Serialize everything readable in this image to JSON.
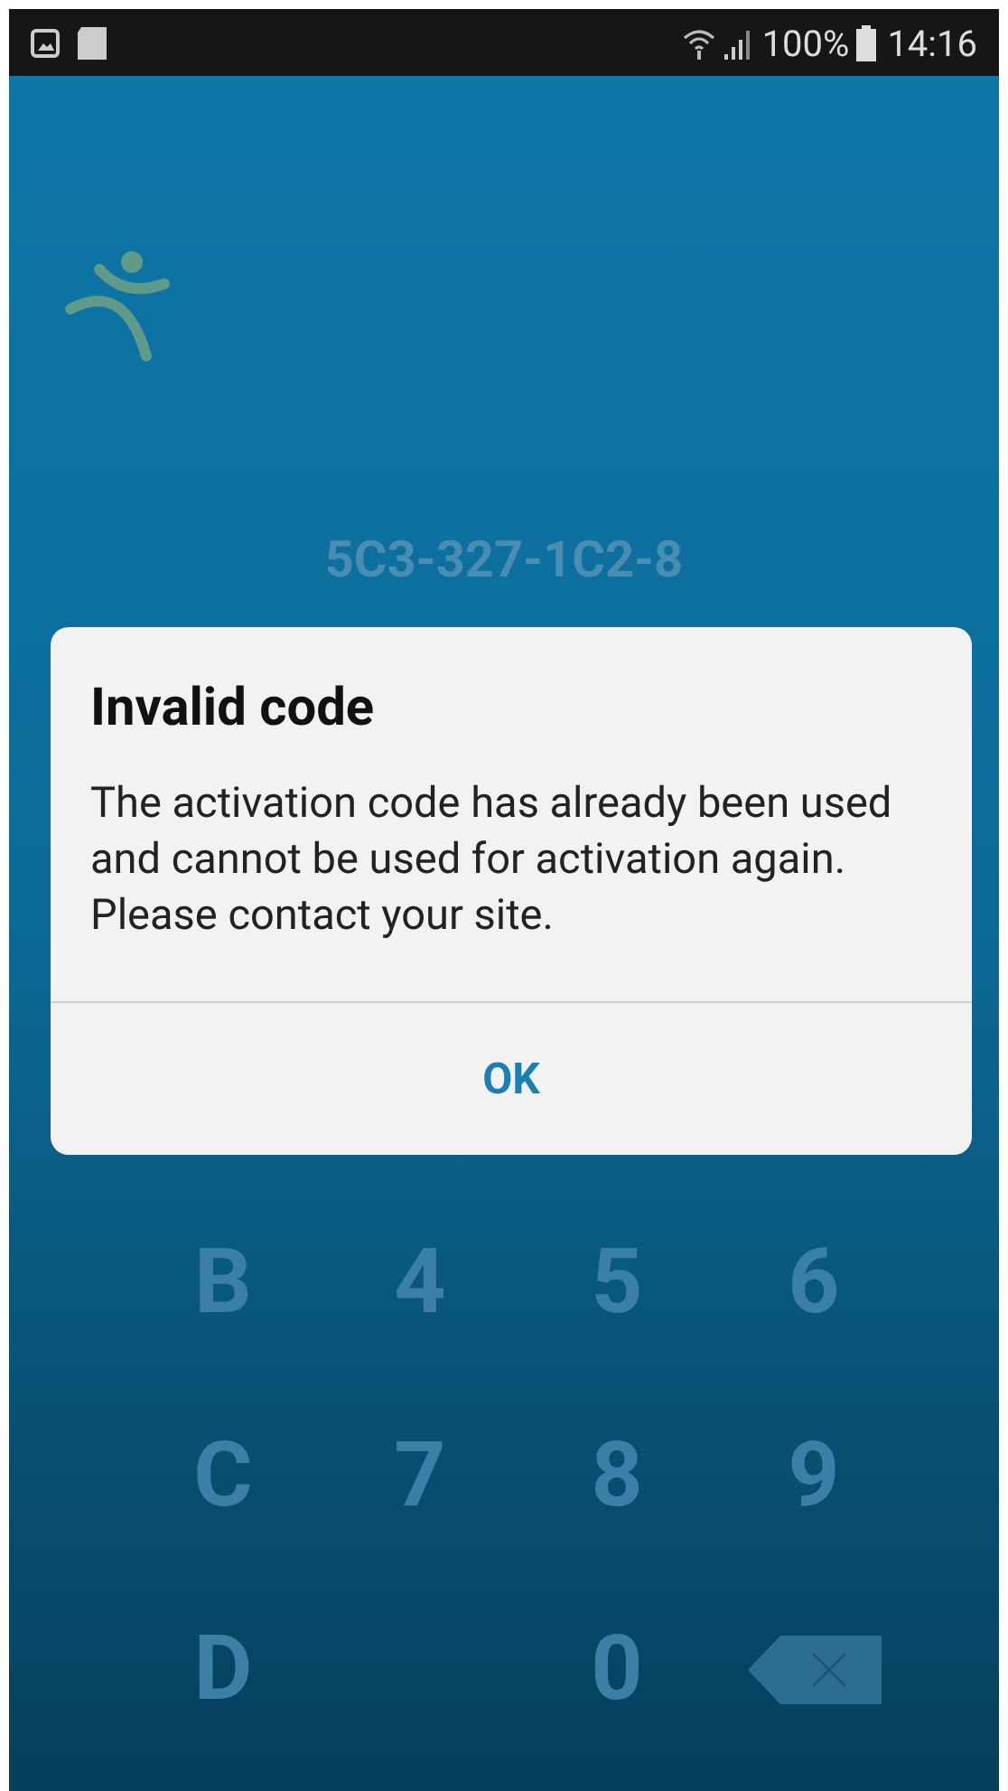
{
  "status_bar": {
    "battery": "100%",
    "time": "14:16"
  },
  "activation_code": "5C3-327-1C2-8",
  "keypad": [
    {
      "kind": "key",
      "label": "B"
    },
    {
      "kind": "key",
      "label": "4"
    },
    {
      "kind": "key",
      "label": "5"
    },
    {
      "kind": "key",
      "label": "6"
    },
    {
      "kind": "key",
      "label": "C"
    },
    {
      "kind": "key",
      "label": "7"
    },
    {
      "kind": "key",
      "label": "8"
    },
    {
      "kind": "key",
      "label": "9"
    },
    {
      "kind": "key",
      "label": "D"
    },
    {
      "kind": "blank"
    },
    {
      "kind": "key",
      "label": "0"
    },
    {
      "kind": "backspace"
    }
  ],
  "dialog": {
    "title": "Invalid code",
    "message": "The activation code has already been used and cannot be used for activation again. Please contact your site.",
    "buttons": [
      "OK"
    ]
  }
}
